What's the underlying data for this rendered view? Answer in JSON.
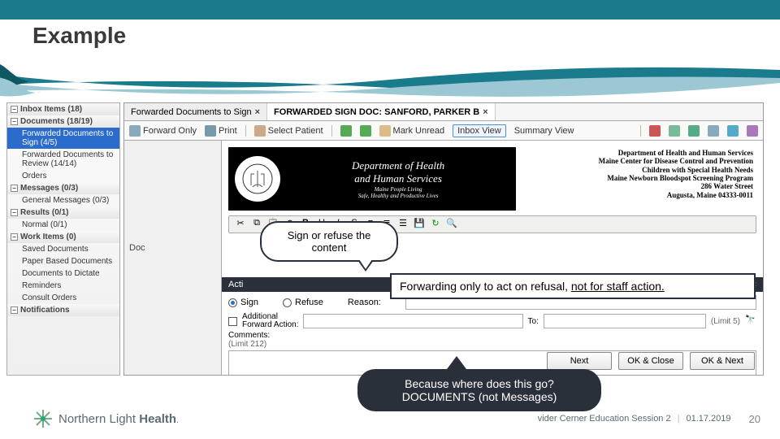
{
  "slide": {
    "title": "Example",
    "footer_session": "vider Cerner Education Session 2",
    "footer_date": "01.17.2019",
    "footer_page": "20",
    "brand": "Northern Light Health"
  },
  "tree": {
    "groups": [
      {
        "label": "Inbox Items (18)",
        "items": []
      },
      {
        "label": "Documents (18/19)",
        "items": [
          {
            "label": "Forwarded Documents to Sign (4/5)",
            "sel": true
          },
          {
            "label": "Forwarded Documents to Review (14/14)"
          },
          {
            "label": "Orders"
          }
        ]
      },
      {
        "label": "Messages (0/3)",
        "items": [
          {
            "label": "General Messages (0/3)"
          }
        ]
      },
      {
        "label": "Results (0/1)",
        "items": [
          {
            "label": "Normal (0/1)"
          }
        ]
      },
      {
        "label": "Work Items (0)",
        "items": [
          {
            "label": "Saved Documents"
          },
          {
            "label": "Paper Based Documents"
          },
          {
            "label": "Documents to Dictate"
          },
          {
            "label": "Reminders"
          },
          {
            "label": "Consult Orders"
          }
        ]
      },
      {
        "label": "Notifications",
        "items": []
      }
    ]
  },
  "tabs": [
    {
      "label": "Forwarded Documents to Sign",
      "active": false
    },
    {
      "label": "FORWARDED SIGN DOC: SANFORD, PARKER B",
      "active": true
    }
  ],
  "toolbar": {
    "forward_only": "Forward Only",
    "print": "Print",
    "select_patient": "Select Patient",
    "mark_unread": "Mark Unread",
    "inbox_view": "Inbox View",
    "summary_view": "Summary View"
  },
  "doc_header_left": {
    "line1": "Department of Health",
    "line2": "and Human Services",
    "line3": "Maine People Living",
    "line4": "Safe, Healthy and Productive Lives"
  },
  "doc_header_right": {
    "l1": "Department of Health and Human Services",
    "l2": "Maine Center for Disease Control and Prevention",
    "l3": "Children with Special Health Needs",
    "l4": "Maine Newborn Bloodspot Screening Program",
    "l5": "286 Water Street",
    "l6": "Augusta, Maine 04333-0011"
  },
  "action_bar": {
    "label": "Acti",
    "right": "«"
  },
  "doc_row_label": "Doc",
  "sign_row": {
    "sign": "Sign",
    "refuse": "Refuse",
    "reason_label": "Reason:"
  },
  "forward_row": {
    "label1": "Additional",
    "label2": "Forward Action:",
    "to": "To:",
    "limit": "(Limit 5)"
  },
  "comments": {
    "label": "Comments:",
    "limit": "(Limit 212)"
  },
  "buttons": {
    "next": "Next",
    "ok_close": "OK & Close",
    "ok_next": "OK & Next"
  },
  "callouts": {
    "c1": "Sign or refuse the content",
    "c2_pre": "Forwarding only to act on refusal, ",
    "c2_u": "not for staff action.",
    "c3_l1": "Because where does this go?",
    "c3_l2": "DOCUMENTS (not Messages)"
  }
}
